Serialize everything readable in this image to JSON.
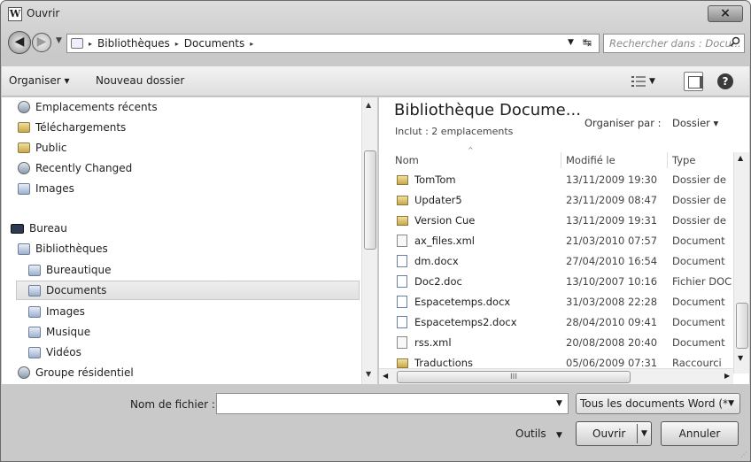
{
  "window": {
    "title": "Ouvrir",
    "app_icon_letter": "W",
    "close_symbol": "×"
  },
  "address": {
    "crumbs": [
      "Bibliothèques",
      "Documents"
    ],
    "separator": "▸",
    "search_placeholder": "Rechercher dans : Docu..."
  },
  "toolbar": {
    "organize_label": "Organiser ▾",
    "new_folder_label": "Nouveau dossier",
    "help_label": "?"
  },
  "nav": {
    "items": [
      {
        "label": "Emplacements récents",
        "icon": "recent-places-icon"
      },
      {
        "label": "Téléchargements",
        "icon": "downloads-icon"
      },
      {
        "label": "Public",
        "icon": "folder-icon"
      },
      {
        "label": "Recently Changed",
        "icon": "recently-changed-icon"
      },
      {
        "label": "Images",
        "icon": "images-icon"
      },
      {
        "label": "Bureau",
        "icon": "desktop-icon"
      },
      {
        "label": "Bibliothèques",
        "icon": "libraries-icon"
      },
      {
        "label": "Bureautique",
        "icon": "library-icon"
      },
      {
        "label": "Documents",
        "icon": "documents-library-icon"
      },
      {
        "label": "Images",
        "icon": "images-library-icon"
      },
      {
        "label": "Musique",
        "icon": "music-library-icon"
      },
      {
        "label": "Vidéos",
        "icon": "videos-library-icon"
      },
      {
        "label": "Groupe résidentiel",
        "icon": "homegroup-icon"
      }
    ],
    "selected": "Documents"
  },
  "files": {
    "library_title": "Bibliothèque Docume...",
    "library_subtitle": "Inclut : 2 emplacements",
    "arrange_label": "Organiser par :",
    "arrange_value": "Dossier ▾",
    "columns": {
      "name": "Nom",
      "modified": "Modifié le",
      "type": "Type"
    },
    "rows": [
      {
        "name": "TomTom",
        "date": "13/11/2009 19:30",
        "type": "Dossier de",
        "kind": "folder"
      },
      {
        "name": "Updater5",
        "date": "23/11/2009 08:47",
        "type": "Dossier de",
        "kind": "folder"
      },
      {
        "name": "Version Cue",
        "date": "13/11/2009 19:31",
        "type": "Dossier de",
        "kind": "folder"
      },
      {
        "name": "ax_files.xml",
        "date": "21/03/2010 07:57",
        "type": "Document",
        "kind": "xml"
      },
      {
        "name": "dm.docx",
        "date": "27/04/2010 16:54",
        "type": "Document",
        "kind": "doc"
      },
      {
        "name": "Doc2.doc",
        "date": "13/10/2007 10:16",
        "type": "Fichier DOC",
        "kind": "doc"
      },
      {
        "name": "Espacetemps.docx",
        "date": "31/03/2008 22:28",
        "type": "Document",
        "kind": "doc"
      },
      {
        "name": "Espacetemps2.docx",
        "date": "28/04/2010 09:41",
        "type": "Document",
        "kind": "doc"
      },
      {
        "name": "rss.xml",
        "date": "20/08/2008 20:40",
        "type": "Document",
        "kind": "xml"
      },
      {
        "name": "Traductions",
        "date": "05/06/2009 07:31",
        "type": "Raccourci",
        "kind": "folder"
      }
    ],
    "hscroll_grip": "III"
  },
  "bottom": {
    "filename_label": "Nom de fichier :",
    "filename_value": "",
    "filetype_value": "Tous les documents Word (*",
    "tools_label": "Outils",
    "open_label": "Ouvrir",
    "cancel_label": "Annuler"
  }
}
